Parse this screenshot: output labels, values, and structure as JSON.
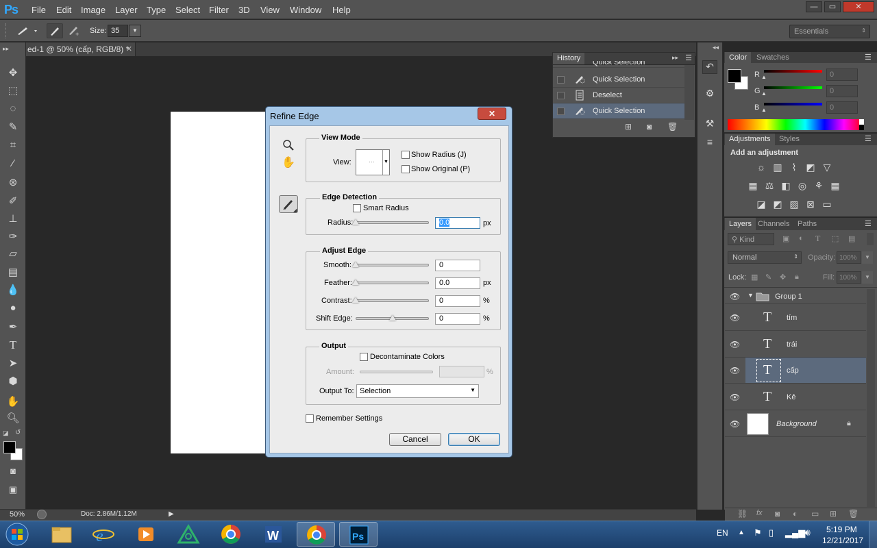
{
  "app": {
    "logo": "Ps"
  },
  "menu": [
    "File",
    "Edit",
    "Image",
    "Layer",
    "Type",
    "Select",
    "Filter",
    "3D",
    "View",
    "Window",
    "Help"
  ],
  "window_controls": {
    "minimize": "—",
    "restore": "▭",
    "close": "✕"
  },
  "options_bar": {
    "size_label": "Size:",
    "size_value": "35",
    "workspace": "Essentials"
  },
  "document": {
    "tab_title": "ed-1 @ 50% (cấp, RGB/8) *",
    "zoom": "50%",
    "doc_info": "Doc: 2.86M/1.12M"
  },
  "history": {
    "tab": "History",
    "items": [
      {
        "label": "Quick Selection"
      },
      {
        "label": "Quick Selection"
      },
      {
        "label": "Deselect"
      },
      {
        "label": "Quick Selection"
      }
    ]
  },
  "color_panel": {
    "tabs": [
      "Color",
      "Swatches"
    ],
    "r_label": "R",
    "g_label": "G",
    "b_label": "B",
    "r_value": "0",
    "g_value": "0",
    "b_value": "0",
    "fg": "#000000",
    "bg": "#ffffff"
  },
  "adjustments": {
    "tabs": [
      "Adjustments",
      "Styles"
    ],
    "heading": "Add an adjustment"
  },
  "layers": {
    "tabs": [
      "Layers",
      "Channels",
      "Paths"
    ],
    "filter_label": "Kind",
    "blend_mode": "Normal",
    "opacity_label": "Opacity:",
    "opacity_value": "100%",
    "lock_label": "Lock:",
    "fill_label": "Fill:",
    "fill_value": "100%",
    "items": [
      {
        "name": "Group 1",
        "type": "group"
      },
      {
        "name": "tím",
        "type": "text"
      },
      {
        "name": "trái",
        "type": "text"
      },
      {
        "name": "cấp",
        "type": "text",
        "selected": true
      },
      {
        "name": "Kẻ",
        "type": "text"
      },
      {
        "name": "Background",
        "type": "image"
      }
    ]
  },
  "dialog": {
    "title": "Refine Edge",
    "close": "✕",
    "view_mode": {
      "title": "View Mode",
      "view_label": "View:",
      "show_radius": "Show Radius (J)",
      "show_original": "Show Original (P)"
    },
    "edge_detection": {
      "title": "Edge Detection",
      "smart_radius": "Smart Radius",
      "radius_label": "Radius:",
      "radius_value": "0.0",
      "radius_unit": "px"
    },
    "adjust_edge": {
      "title": "Adjust Edge",
      "smooth_label": "Smooth:",
      "smooth_value": "0",
      "feather_label": "Feather:",
      "feather_value": "0.0",
      "feather_unit": "px",
      "contrast_label": "Contrast:",
      "contrast_value": "0",
      "contrast_unit": "%",
      "shift_label": "Shift Edge:",
      "shift_value": "0",
      "shift_unit": "%"
    },
    "output": {
      "title": "Output",
      "decontaminate": "Decontaminate Colors",
      "amount_label": "Amount:",
      "amount_unit": "%",
      "output_to_label": "Output To:",
      "output_to_value": "Selection"
    },
    "remember": "Remember Settings",
    "cancel": "Cancel",
    "ok": "OK"
  },
  "taskbar": {
    "lang": "EN",
    "time": "5:19 PM",
    "date": "12/21/2017"
  }
}
